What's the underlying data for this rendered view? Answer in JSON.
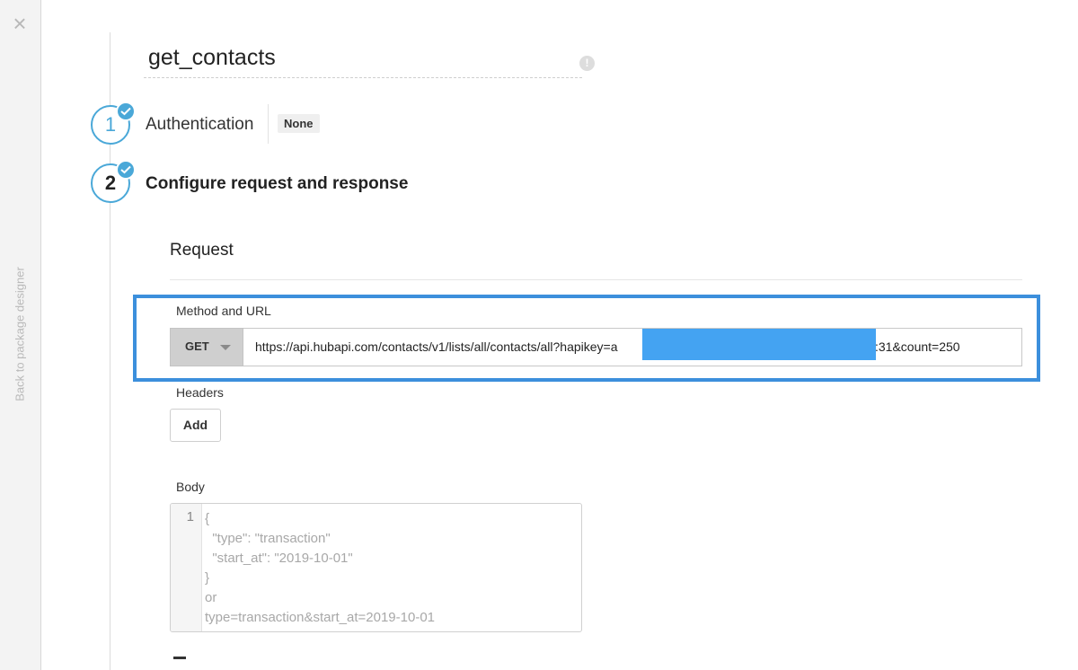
{
  "sidebar": {
    "close_icon": "×",
    "back_label": "Back to package designer"
  },
  "header": {
    "title": "get_contacts",
    "info_icon": "!"
  },
  "steps": [
    {
      "number": "1",
      "label": "Authentication",
      "badge": "None",
      "completed": true
    },
    {
      "number": "2",
      "label": "Configure request and response",
      "completed": true
    }
  ],
  "request": {
    "section_title": "Request",
    "method_url_label": "Method and URL",
    "method": "GET",
    "url_visible_start": "https://api.hubapi.com/contacts/v1/lists/all/contacts/all?hapikey=a",
    "url_visible_end": ":31&count=250",
    "headers_label": "Headers",
    "add_button": "Add",
    "body_label": "Body",
    "body_editor": {
      "line_number": "1",
      "lines": [
        "{",
        "  \"type\": \"transaction\"",
        "  \"start_at\": \"2019-10-01\"",
        "}",
        "or",
        "type=transaction&start_at=2019-10-01"
      ]
    }
  },
  "colors": {
    "accent": "#4aa8d8",
    "highlight_border": "#3c8fdc",
    "redaction": "#44a3f2"
  }
}
